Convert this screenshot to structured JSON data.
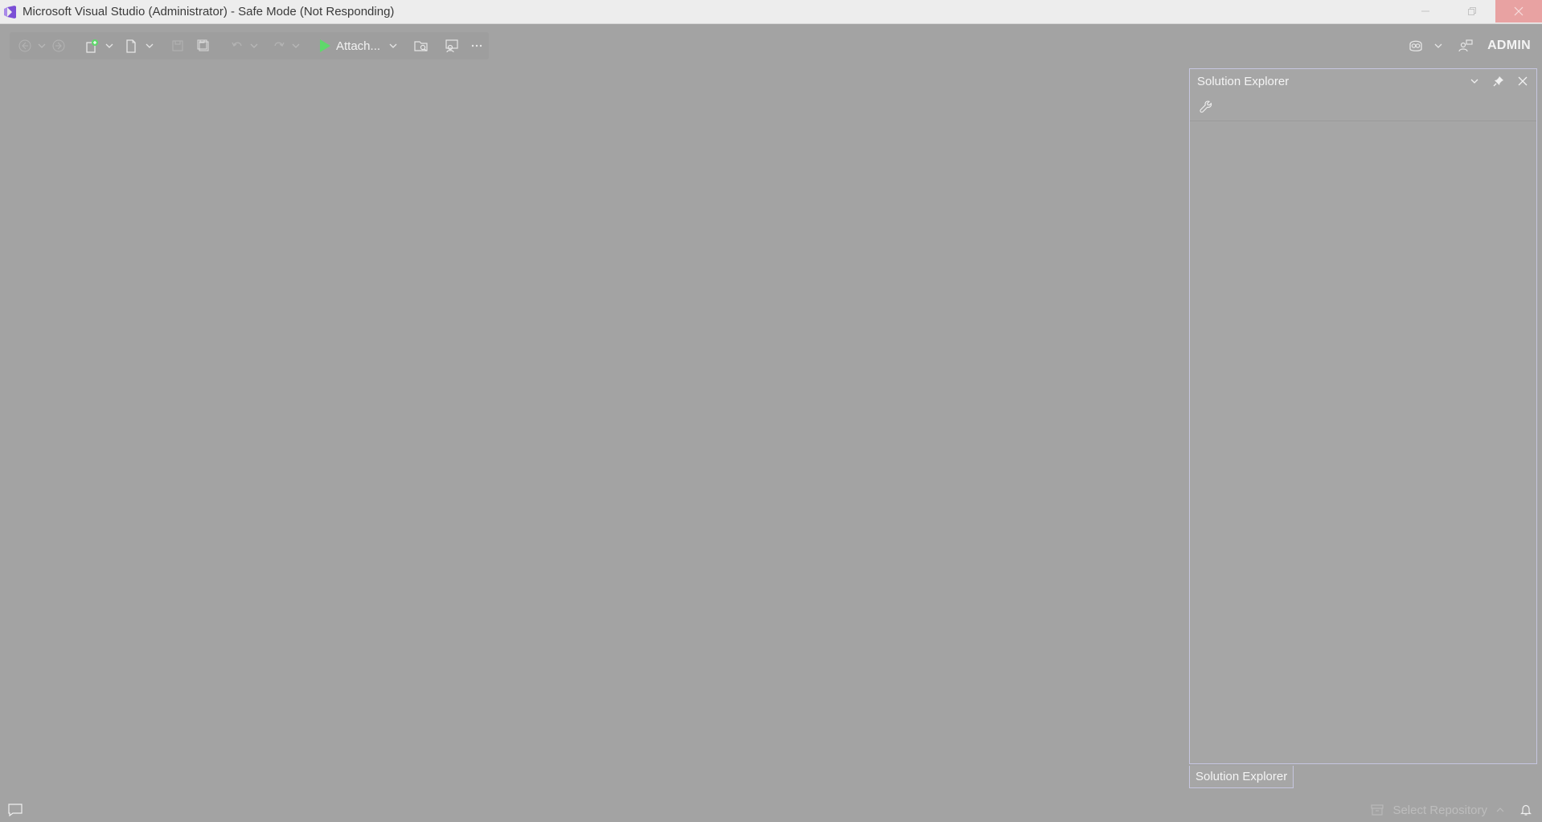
{
  "window": {
    "title": "Microsoft Visual Studio (Administrator) - Safe Mode (Not Responding)"
  },
  "toolbar": {
    "run_label": "Attach..."
  },
  "account": {
    "user_label": "ADMIN"
  },
  "solution_explorer": {
    "title": "Solution Explorer",
    "tab_label": "Solution Explorer"
  },
  "status_bar": {
    "repository_label": "Select Repository"
  },
  "colors": {
    "accent": "#7b4fd6",
    "run_green": "#5fd86b",
    "background": "#a3a3a3"
  }
}
